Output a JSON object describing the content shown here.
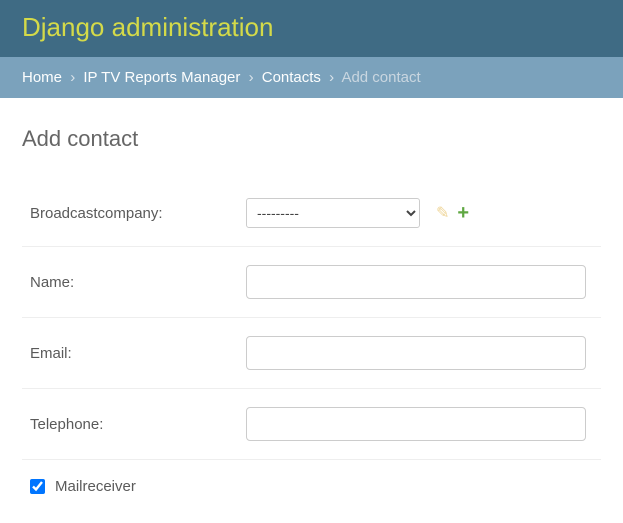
{
  "header": {
    "site_title": "Django administration"
  },
  "breadcrumbs": {
    "home": "Home",
    "app": "IP TV Reports Manager",
    "model": "Contacts",
    "current": "Add contact"
  },
  "page": {
    "title": "Add contact"
  },
  "form": {
    "broadcastcompany": {
      "label": "Broadcastcompany:",
      "selected": "---------",
      "edit_icon": "pencil-icon",
      "add_icon": "plus-icon"
    },
    "name": {
      "label": "Name:",
      "value": ""
    },
    "email": {
      "label": "Email:",
      "value": ""
    },
    "telephone": {
      "label": "Telephone:",
      "value": ""
    },
    "mailreceiver": {
      "label": "Mailreceiver",
      "checked": true
    }
  }
}
